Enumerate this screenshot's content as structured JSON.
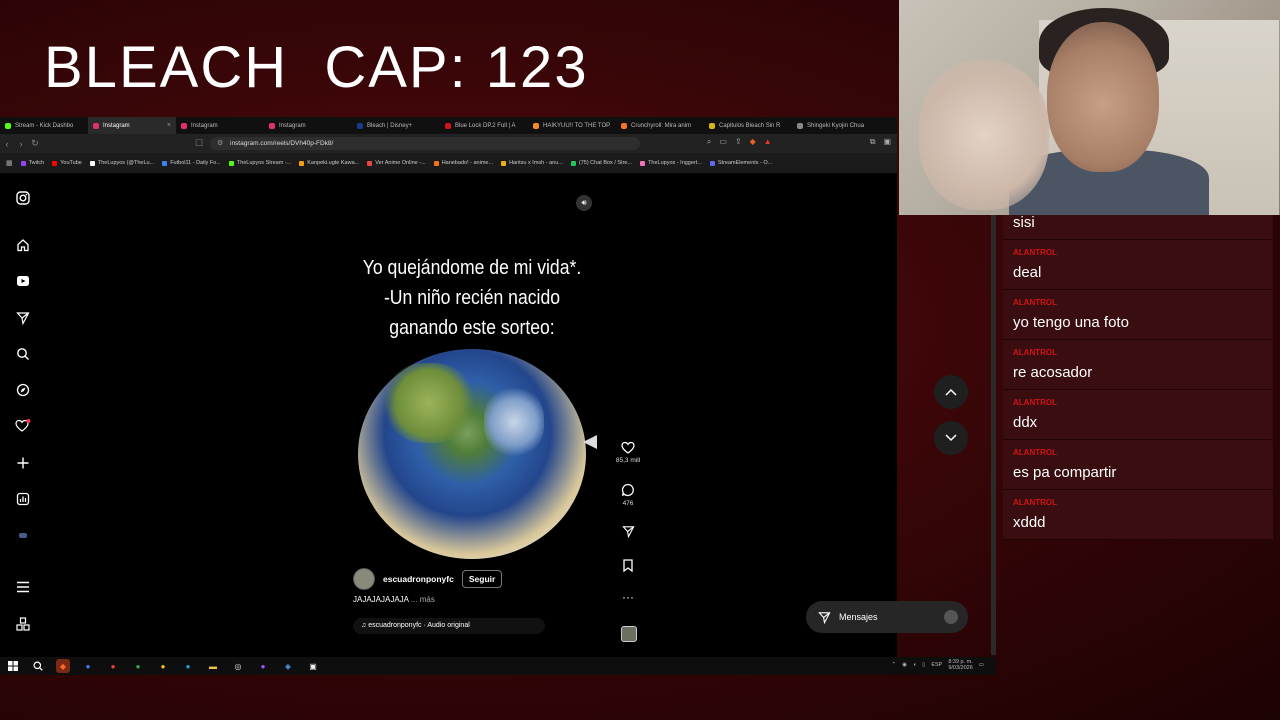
{
  "overlay": {
    "title": "BLEACH  CAP: 123"
  },
  "browser": {
    "tabs": [
      {
        "label": "Stream - Kick Dashbo",
        "color": "#53fc18",
        "active": false
      },
      {
        "label": "Instagram",
        "color": "#e1306c",
        "active": true
      },
      {
        "label": "Instagram",
        "color": "#e1306c",
        "active": false
      },
      {
        "label": "Instagram",
        "color": "#e1306c",
        "active": false
      },
      {
        "label": "Bleach | Disney+",
        "color": "#1a3a8a",
        "active": false
      },
      {
        "label": "Blue Lock DP.2 Full | A",
        "color": "#d01418",
        "active": false
      },
      {
        "label": "HAIKYUU!! TO THE TOP",
        "color": "#f28c28",
        "active": false
      },
      {
        "label": "Crunchyroll: Mira anim",
        "color": "#f47521",
        "active": false
      },
      {
        "label": "Capitulos Bleach Sin R",
        "color": "#d6b417",
        "active": false
      },
      {
        "label": "Shingeki Kyojin Chua",
        "color": "#888888",
        "active": false
      }
    ],
    "url": "instagram.com/reels/DVh40p-FDk8/",
    "bookmarks": [
      {
        "label": "Twitch",
        "color": "#9146ff"
      },
      {
        "label": "YouTube",
        "color": "#ff0000"
      },
      {
        "label": "TheLupyos (@TheLu...",
        "color": "#ffffff"
      },
      {
        "label": "Futbol11 - Daily Fo...",
        "color": "#3b82f6"
      },
      {
        "label": "TheLupyos Stream -...",
        "color": "#53fc18"
      },
      {
        "label": "Kanpeki.ugte Kawa...",
        "color": "#f59e0b"
      },
      {
        "label": "Ver Anime Online -...",
        "color": "#ef4444"
      },
      {
        "label": "Hanebado! - anime...",
        "color": "#f97316"
      },
      {
        "label": "Hantsu x Imsh - anu...",
        "color": "#eab308"
      },
      {
        "label": "(75) Chat Box / Stre...",
        "color": "#22c55e"
      },
      {
        "label": "TheLupyos - Inggert...",
        "color": "#f472b6"
      },
      {
        "label": "StreamElements - O...",
        "color": "#6366f1"
      }
    ]
  },
  "reel": {
    "text_lines": [
      "Yo quejándome de mi vida*.",
      "-Un niño recién nacido",
      "ganando este sorteo:"
    ],
    "author": "escuadronponyfc",
    "follow_label": "Seguir",
    "caption": "JAJAJAJAJAJA",
    "more_label": "... más",
    "audio": "escuadronponyfc · Audio original"
  },
  "actions": {
    "likes": "85,3 mill",
    "comments": "476"
  },
  "messages_label": "Mensajes",
  "chat": [
    {
      "user": "",
      "text": "sisi"
    },
    {
      "user": "ALANTROL",
      "text": "deal"
    },
    {
      "user": "ALANTROL",
      "text": "yo tengo una foto"
    },
    {
      "user": "ALANTROL",
      "text": "re acosador"
    },
    {
      "user": "ALANTROL",
      "text": "ddx"
    },
    {
      "user": "ALANTROL",
      "text": "es pa compartir"
    },
    {
      "user": "ALANTROL",
      "text": "xddd"
    }
  ],
  "taskbar": {
    "time": "8:39 p. m.",
    "date": "9/03/2026",
    "lang": "ESP"
  }
}
